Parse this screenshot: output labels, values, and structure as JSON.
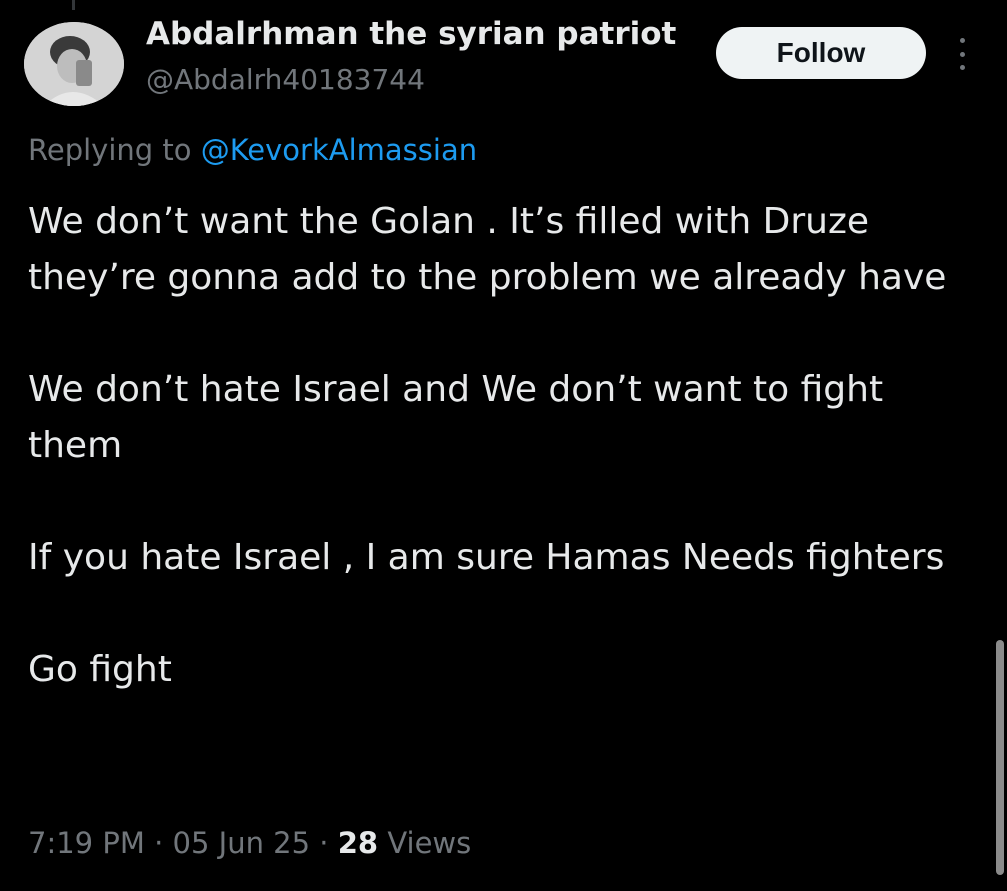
{
  "tweet": {
    "display_name": "Abdalrhman the syrian patriot",
    "handle": "@Abdalrh40183744",
    "follow_label": "Follow",
    "replying_prefix": "Replying to",
    "replying_to": "@KevorkAlmassian",
    "paragraphs": [
      "We don’t want the Golan . It’s filled with Druze they’re gonna add to the problem we already have",
      "We don’t hate Israel and We don’t want to fight them",
      "If you hate Israel , I am sure Hamas Needs fighters",
      "Go fight"
    ],
    "time": "7:19 PM",
    "date": "05 Jun 25",
    "separator": "·",
    "views_count": "28",
    "views_label": "Views"
  },
  "icons": {
    "more": "more-vertical-icon"
  },
  "colors": {
    "background": "#000000",
    "primary_text": "#e7e9ea",
    "secondary_text": "#71767b",
    "link": "#1d9bf0",
    "follow_bg": "#eff3f4"
  }
}
